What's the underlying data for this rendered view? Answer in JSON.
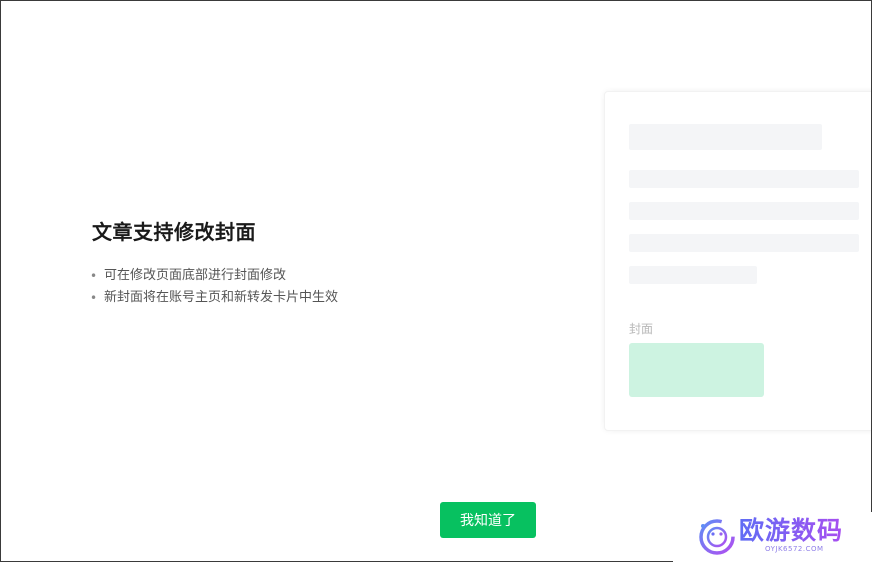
{
  "dialog": {
    "title": "文章支持修改封面",
    "bullets": [
      "可在修改页面底部进行封面修改",
      "新封面将在账号主页和新转发卡片中生效"
    ],
    "confirm_label": "我知道了"
  },
  "preview": {
    "cover_label": "封面",
    "cover_color": "#cdf3e1"
  },
  "watermark": {
    "text": "欧游数码",
    "subtext": "OYJK6572.COM"
  },
  "colors": {
    "accent": "#07c160",
    "border": "#3a3a3a"
  }
}
